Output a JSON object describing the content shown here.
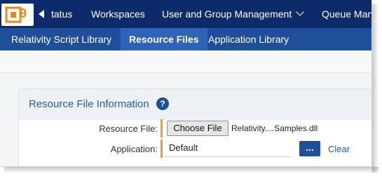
{
  "logo": {
    "number": "9"
  },
  "topbar": {
    "items": [
      {
        "label": "tatus"
      },
      {
        "label": "Workspaces"
      },
      {
        "label": "User and Group Management"
      },
      {
        "label": "Queue Man"
      }
    ]
  },
  "subbar": {
    "tabs": [
      {
        "label": "Relativity Script Library",
        "active": false
      },
      {
        "label": "Resource Files",
        "active": true
      },
      {
        "label": "Application Library",
        "active": false
      }
    ]
  },
  "card": {
    "title": "Resource File Information",
    "help_icon_text": "?",
    "fields": {
      "resource_file": {
        "label": "Resource File:",
        "button_label": "Choose File",
        "file_name": "Relativity....Samples.dll"
      },
      "application": {
        "label": "Application:",
        "value": "Default",
        "ellipsis_label": "...",
        "clear_label": "Clear"
      }
    }
  },
  "colors": {
    "topbar": "#0d2b6b",
    "subbar": "#1f4f9a",
    "active_tab": "#2f63b7",
    "accent_orange": "#e58a1f",
    "required_marker": "#e8a02a",
    "link_blue": "#2b5aa3"
  }
}
